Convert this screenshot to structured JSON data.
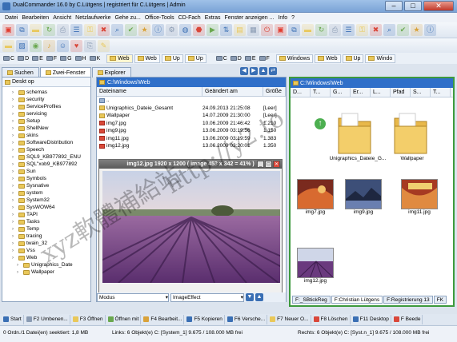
{
  "window": {
    "title": "DualCommander 16.0 by C.Lütgens | registriert für C.Lütgens | Admin",
    "minimize": "–",
    "maximize": "□",
    "close": "✕"
  },
  "menubar": [
    "Datei",
    "Bearbeiten",
    "Ansicht",
    "Netzlaufwerke",
    "Gehe zu...",
    "Office-Tools",
    "CD-Fach",
    "Extras",
    "Fenster anzeigen ...",
    "Info",
    "?"
  ],
  "drivebar_left": {
    "drives": [
      "C",
      "D",
      "E",
      "F",
      "G",
      "H",
      "K"
    ],
    "crumbs": [
      {
        "label": "Web",
        "active": true
      },
      {
        "label": "Web"
      },
      {
        "label": "Up"
      },
      {
        "label": "Up"
      }
    ]
  },
  "drivebar_right": {
    "drives": [
      "C",
      "D",
      "E",
      "F"
    ],
    "crumbs": [
      {
        "label": "Windows"
      },
      {
        "label": "Web"
      },
      {
        "label": "Up"
      },
      {
        "label": "Windo"
      }
    ]
  },
  "left_tabs": [
    {
      "label": "Suchen",
      "active": false
    },
    {
      "label": "Zwei-Fenster",
      "active": true
    },
    {
      "label": "Explorer",
      "active": false
    }
  ],
  "tree": {
    "header": "Deskt op",
    "items": [
      {
        "label": "schemas",
        "indent": 2
      },
      {
        "label": "security",
        "indent": 2
      },
      {
        "label": "ServiceProfiles",
        "indent": 2
      },
      {
        "label": "servicing",
        "indent": 2
      },
      {
        "label": "Setup",
        "indent": 2
      },
      {
        "label": "ShellNew",
        "indent": 2
      },
      {
        "label": "skins",
        "indent": 2
      },
      {
        "label": "SoftwareDistribution",
        "indent": 2
      },
      {
        "label": "Speech",
        "indent": 2
      },
      {
        "label": "SQL9_KB977892_ENU",
        "indent": 2
      },
      {
        "label": "SQL\"xob9_KB977892",
        "indent": 2
      },
      {
        "label": "Sun",
        "indent": 2
      },
      {
        "label": "Symbols",
        "indent": 2
      },
      {
        "label": "Sysnative",
        "indent": 2
      },
      {
        "label": "system",
        "indent": 2
      },
      {
        "label": "System32",
        "indent": 2
      },
      {
        "label": "SysWOW64",
        "indent": 2
      },
      {
        "label": "TAPI",
        "indent": 2
      },
      {
        "label": "Tasks",
        "indent": 2
      },
      {
        "label": "Temp",
        "indent": 2
      },
      {
        "label": "tracing",
        "indent": 2
      },
      {
        "label": "twain_32",
        "indent": 2
      },
      {
        "label": "Vss",
        "indent": 2
      },
      {
        "label": "Web",
        "indent": 2
      },
      {
        "label": "Unigraphics_Date",
        "indent": 3
      },
      {
        "label": "Wallpaper",
        "indent": 3
      }
    ]
  },
  "mid_pane": {
    "path": "C:\\Windows\\Web",
    "columns": [
      "Dateiname",
      "Geändert am",
      "Größe"
    ],
    "files": [
      {
        "name": "..",
        "date": "",
        "size": "",
        "kind": "up"
      },
      {
        "name": "Unigraphics_Dateie_Gesamt",
        "date": "24.09.2013 21:25:08",
        "size": "[Leer]",
        "kind": "folder"
      },
      {
        "name": "Wallpaper",
        "date": "14.07.2009 21:30:00",
        "size": "[Leer]",
        "kind": "folder"
      },
      {
        "name": "img7.jpg",
        "date": "10.06.2009 21:46:42",
        "size": "1.210",
        "kind": "img"
      },
      {
        "name": "img9.jpg",
        "date": "13.06.2009 03:19:56",
        "size": "1.150",
        "kind": "img"
      },
      {
        "name": "img11.jpg",
        "date": "13.06.2009 03:19:59",
        "size": "1.383",
        "kind": "img"
      },
      {
        "name": "img12.jpg",
        "date": "13.06.2009 03:20:01",
        "size": "1.350",
        "kind": "img"
      }
    ],
    "preview_title": "img12.jpg 1920 x 1200 ( image 453 x 342 = 41% )",
    "mode_label": "Modus",
    "effect_label": "ImageEffect"
  },
  "right_pane": {
    "path": "C:\\Windows\\Web",
    "columns": [
      "D...",
      "T...",
      "G...",
      "Er...",
      "L...",
      "Pfad",
      "S...",
      "T..."
    ],
    "folders": [
      "Unigraphics_Dateie_G...",
      "Wallpaper"
    ],
    "thumbs": [
      "img7.jpg",
      "img9.jpg",
      "img11.jpg",
      "img12.jpg"
    ],
    "tabs": [
      {
        "label": "F:_SBtickReg",
        "active": false
      },
      {
        "label": "F:Christian Lütgens",
        "active": true
      },
      {
        "label": "F:Registrierung 13",
        "active": false
      },
      {
        "label": "FK",
        "active": false
      }
    ]
  },
  "fkeys": [
    {
      "label": "Start",
      "color": "#3a6fb4"
    },
    {
      "label": "F2 Umbenen...",
      "color": "#8a9bb3"
    },
    {
      "label": "F3 Öffnen",
      "color": "#e9c85a"
    },
    {
      "label": "Öffnen mit",
      "color": "#6aa84f"
    },
    {
      "label": "F4 Bearbeit...",
      "color": "#d9a23a"
    },
    {
      "label": "F5 Kopieren",
      "color": "#3a6fb4"
    },
    {
      "label": "F6 Versche...",
      "color": "#3a6fb4"
    },
    {
      "label": "F7 Neuer O...",
      "color": "#e9c85a"
    },
    {
      "label": "F8 Löschen",
      "color": "#d9473a"
    },
    {
      "label": "F11 Desktop",
      "color": "#3a6fb4"
    },
    {
      "label": "F Beede",
      "color": "#d9473a"
    }
  ],
  "status": {
    "left": "0 Ordn./1 Datei(en) seektiert: 1,8 MB",
    "mid": "Links: 6   Objekt(e)   C: [System_1]   9.675 / 108.000 MB frei",
    "right": "Rechts: 6 Objekt(e)   C: [Syst.n_1]   9.675 / 108.000 MB frei"
  },
  "watermark": {
    "line1": "xyz軟體補給站",
    "line2": "http://y2.to"
  },
  "colors": {
    "path_bar": "#2f6fc9",
    "active_pane_border": "#3d9a3d",
    "title_gradient_top": "#9fc1e8"
  }
}
